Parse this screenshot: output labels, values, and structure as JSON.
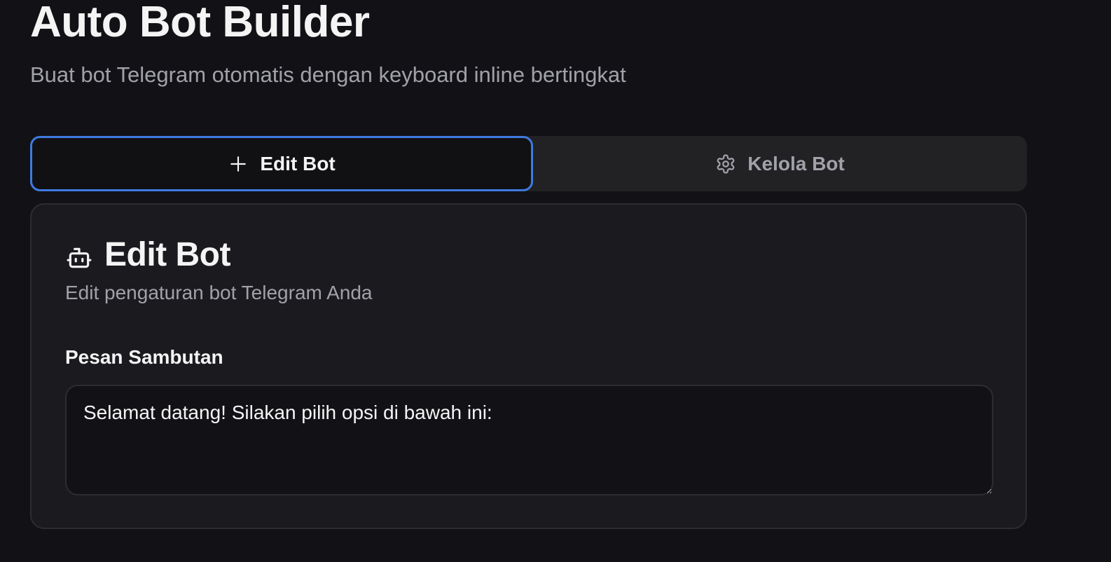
{
  "header": {
    "title": "Auto Bot Builder",
    "subtitle": "Buat bot Telegram otomatis dengan keyboard inline bertingkat"
  },
  "tabs": [
    {
      "label": "Edit Bot",
      "icon": "plus-icon",
      "active": true
    },
    {
      "label": "Kelola Bot",
      "icon": "gear-icon",
      "active": false
    }
  ],
  "card": {
    "icon": "bot-icon",
    "title": "Edit Bot",
    "description": "Edit pengaturan bot Telegram Anda",
    "welcome_field": {
      "label": "Pesan Sambutan",
      "value": "Selamat datang! Silakan pilih opsi di bawah ini:"
    }
  },
  "colors": {
    "background": "#121216",
    "card": "#1b1b1f",
    "accent": "#3f7ae0",
    "muted_text": "#a1a1aa"
  }
}
